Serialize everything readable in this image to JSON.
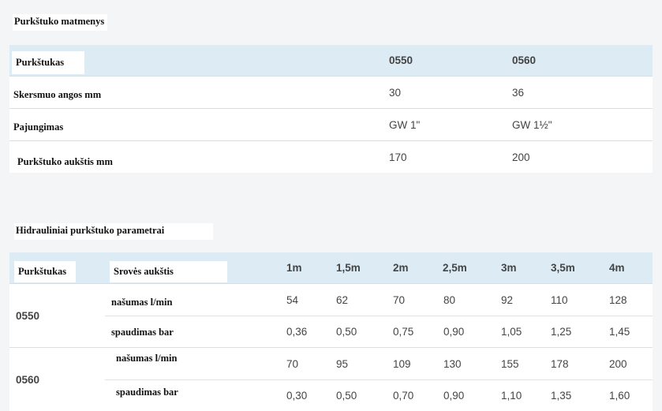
{
  "section1": {
    "title": "Purkštuko matmenys"
  },
  "table1": {
    "header": {
      "label": "Purkštukas",
      "col1": "0550",
      "col2": "0560"
    },
    "rows": [
      {
        "label": "Skersmuo angos mm",
        "col1": "30",
        "col2": "36"
      },
      {
        "label": "Pajungimas",
        "col1": "GW 1\"",
        "col2": "GW 1½\""
      },
      {
        "label": "Purkštuko aukštis mm",
        "col1": "170",
        "col2": "200"
      }
    ]
  },
  "section2": {
    "title": "Hidrauliniai purkštuko parametrai"
  },
  "table2": {
    "header": {
      "label1": "Purkštukas",
      "label2": "Srovės aukštis",
      "heights": [
        "1m",
        "1,5m",
        "2m",
        "2,5m",
        "3m",
        "3,5m",
        "4m"
      ]
    },
    "groups": [
      {
        "name": "0550",
        "rows": [
          {
            "label": "našumas l/min",
            "values": [
              "54",
              "62",
              "70",
              "80",
              "92",
              "110",
              "128"
            ]
          },
          {
            "label": "spaudimas bar",
            "values": [
              "0,36",
              "0,50",
              "0,75",
              "0,90",
              "1,05",
              "1,25",
              "1,45"
            ]
          }
        ]
      },
      {
        "name": "0560",
        "rows": [
          {
            "label": "našumas l/min",
            "values": [
              "70",
              "95",
              "109",
              "130",
              "155",
              "178",
              "200"
            ]
          },
          {
            "label": "spaudimas bar",
            "values": [
              "0,30",
              "0,50",
              "0,70",
              "0,90",
              "1,10",
              "1,35",
              "1,60"
            ]
          }
        ]
      }
    ]
  }
}
